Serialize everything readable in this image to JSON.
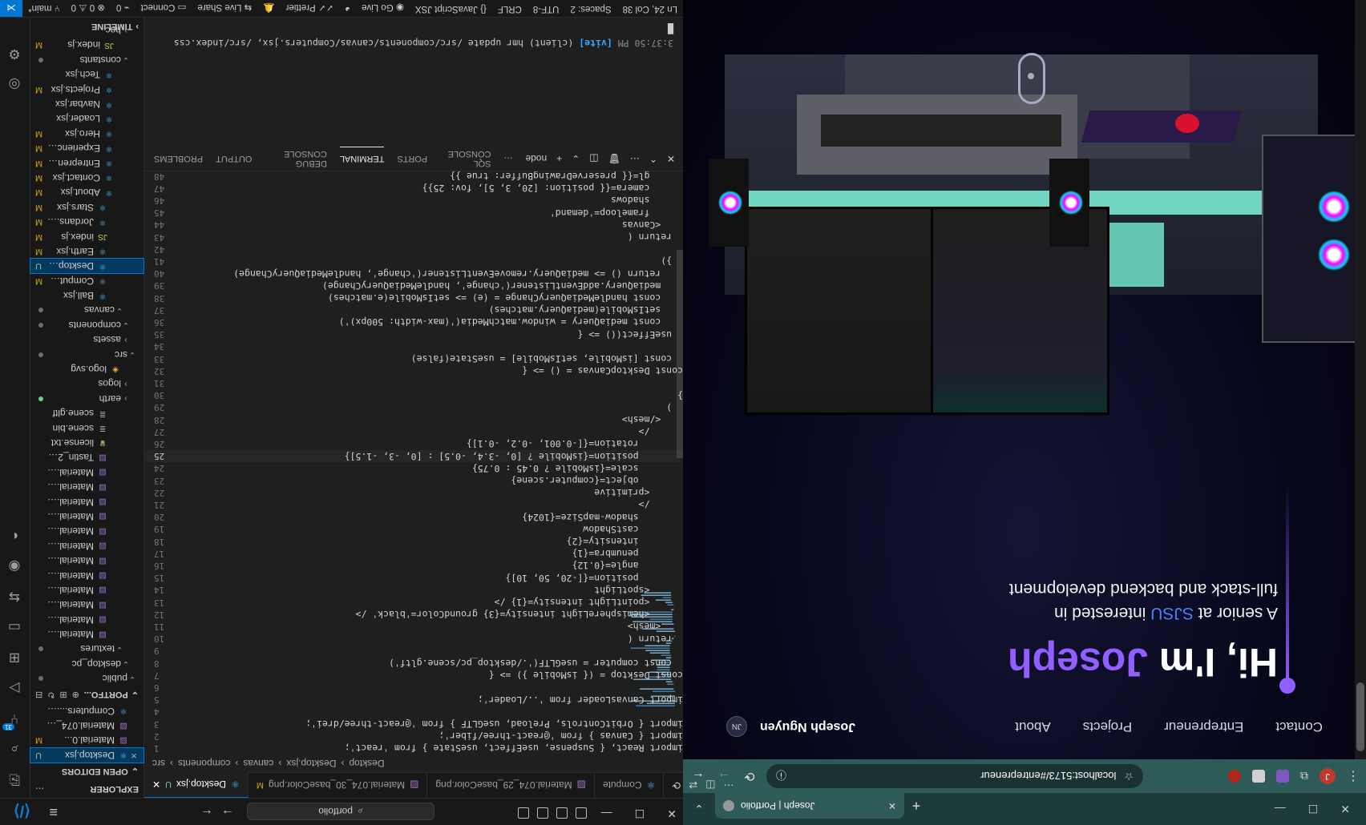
{
  "vscode": {
    "title_bar": {
      "search_text": "portfolio",
      "menu_icon": "hamburger-menu-icon"
    },
    "explorer": {
      "header": "EXPLORER",
      "open_editors_label": "OPEN EDITORS",
      "open_editors": [
        {
          "name": "Desktop.jsx",
          "status": "U",
          "icon": "react"
        },
        {
          "name": "Material.0...",
          "status": "M",
          "icon": "image"
        },
        {
          "name": "Material.074_29_baseColo...",
          "status": "",
          "icon": "image"
        },
        {
          "name": "Computers.... M",
          "status": "",
          "icon": "react"
        }
      ],
      "project_label": "PORTFO...",
      "tree": [
        {
          "name": "public",
          "type": "folder",
          "status": "dot"
        },
        {
          "name": "desktop_pc",
          "type": "folder",
          "status": ""
        },
        {
          "name": "textures",
          "type": "folder",
          "status": "dot"
        },
        {
          "name": "Material.074_29...",
          "type": "image",
          "status": ""
        },
        {
          "name": "Material.07...",
          "type": "image",
          "status": ""
        },
        {
          "name": "Material.074_31...",
          "type": "image",
          "status": ""
        },
        {
          "name": "Material.074_32...",
          "type": "image",
          "status": ""
        },
        {
          "name": "Material.074_33...",
          "type": "image",
          "status": ""
        },
        {
          "name": "Material.074_34...",
          "type": "image",
          "status": ""
        },
        {
          "name": "Material.074_35...",
          "type": "image",
          "status": ""
        },
        {
          "name": "Material.074_36...",
          "type": "image",
          "status": ""
        },
        {
          "name": "Material.074_39...",
          "type": "image",
          "status": ""
        },
        {
          "name": "Material.074_40...",
          "type": "image",
          "status": ""
        },
        {
          "name": "Material.074_69...",
          "type": "image",
          "status": ""
        },
        {
          "name": "Material.074_bas...",
          "type": "image",
          "status": ""
        },
        {
          "name": "Tastin_2_baseCol...",
          "type": "image",
          "status": ""
        },
        {
          "name": "license.txt",
          "type": "license",
          "status": ""
        },
        {
          "name": "scene.bin",
          "type": "bin",
          "status": ""
        },
        {
          "name": "scene.gltf",
          "type": "gltf",
          "status": ""
        },
        {
          "name": "earth",
          "type": "folder-closed",
          "status": "dot-green"
        },
        {
          "name": "logos",
          "type": "folder-closed",
          "status": ""
        },
        {
          "name": "logo.svg",
          "type": "svg",
          "status": ""
        },
        {
          "name": "src",
          "type": "folder",
          "status": "dot"
        },
        {
          "name": "assets",
          "type": "folder-closed",
          "status": ""
        },
        {
          "name": "components",
          "type": "folder",
          "status": "dot"
        },
        {
          "name": "canvas",
          "type": "folder",
          "status": "dot"
        },
        {
          "name": "Ball.jsx",
          "type": "react",
          "status": ""
        },
        {
          "name": "Computers.j...",
          "type": "react",
          "status": "M"
        },
        {
          "name": "Desktop.jsx",
          "type": "react",
          "status": "U",
          "selected": true
        },
        {
          "name": "Earth.jsx",
          "type": "react",
          "status": "M"
        },
        {
          "name": "index.js",
          "type": "js",
          "status": "M"
        },
        {
          "name": "Jordans.jsx",
          "type": "react",
          "status": "M"
        },
        {
          "name": "Stars.jsx",
          "type": "react",
          "status": "M"
        },
        {
          "name": "About.jsx",
          "type": "react",
          "status": "M"
        },
        {
          "name": "Contact.jsx",
          "type": "react",
          "status": "M"
        },
        {
          "name": "Entreprenu...",
          "type": "react",
          "status": "M"
        },
        {
          "name": "Experience.jsx",
          "type": "react",
          "status": "M"
        },
        {
          "name": "Hero.jsx",
          "type": "react",
          "status": "M"
        },
        {
          "name": "Loader.jsx",
          "type": "react",
          "status": ""
        },
        {
          "name": "Navbar.jsx",
          "type": "react",
          "status": ""
        },
        {
          "name": "Projects.jsx",
          "type": "react",
          "status": "M"
        },
        {
          "name": "Tech.jsx",
          "type": "react",
          "status": ""
        },
        {
          "name": "constants",
          "type": "folder",
          "status": "dot"
        },
        {
          "name": "index.js",
          "type": "js",
          "status": "M"
        },
        {
          "name": "hoc",
          "type": "folder-closed",
          "status": ""
        }
      ],
      "timeline_label": "TIMELINE"
    },
    "tabs": [
      {
        "label": "Desktop.jsx",
        "status": "U",
        "active": true
      },
      {
        "label": "Material.074_30_baseColor.png",
        "status": "M",
        "active": false
      },
      {
        "label": "Material.074_29_baseColor.png",
        "status": "",
        "active": false
      },
      {
        "label": "Compute",
        "status": "",
        "active": false
      }
    ],
    "breadcrumbs": [
      "src",
      "components",
      "canvas",
      "Desktop.jsx",
      "Desktop"
    ],
    "code": [
      {
        "n": "1",
        "t": "import React, { Suspense, useEffect, useState } from 'react';"
      },
      {
        "n": "2",
        "t": "import { Canvas } from '@react-three/fiber';"
      },
      {
        "n": "3",
        "t": "import { OrbitControls, Preload, useGLTF } from '@react-three/drei';"
      },
      {
        "n": "4",
        "t": ""
      },
      {
        "n": "5",
        "t": "import CanvasLoader from '../Loader';"
      },
      {
        "n": "6",
        "t": ""
      },
      {
        "n": "7",
        "t": "const Desktop = ({ isMobile }) => {"
      },
      {
        "n": "8",
        "t": "  const computer = useGLTF('./desktop_pc/scene.gltf')"
      },
      {
        "n": "9",
        "t": ""
      },
      {
        "n": "10",
        "t": "  return ("
      },
      {
        "n": "11",
        "t": "    <mesh>"
      },
      {
        "n": "12",
        "t": "      <hemisphereLight intensity={3} groundColor='black' />"
      },
      {
        "n": "13",
        "t": "      <pointLight intensity={1} />"
      },
      {
        "n": "14",
        "t": "      <spotLight"
      },
      {
        "n": "15",
        "t": "        position={[-20, 50, 10]}"
      },
      {
        "n": "16",
        "t": "        angle={0.12}"
      },
      {
        "n": "17",
        "t": "        penumbra={1}"
      },
      {
        "n": "18",
        "t": "        intensity={2}"
      },
      {
        "n": "19",
        "t": "        castShadow"
      },
      {
        "n": "20",
        "t": "        shadow-mapSize={1024}"
      },
      {
        "n": "21",
        "t": "      />"
      },
      {
        "n": "22",
        "t": "      <primitive"
      },
      {
        "n": "23",
        "t": "        object={computer.scene}"
      },
      {
        "n": "24",
        "t": "        scale={isMobile ? 0.45 : 0.75}"
      },
      {
        "n": "25",
        "t": "        position={isMobile ? [0, -3.4, -0.5] : [0, -3, -1.5]}"
      },
      {
        "n": "26",
        "t": "        rotation={[-0.001, -0.2, -0.1]}"
      },
      {
        "n": "27",
        "t": "      />"
      },
      {
        "n": "28",
        "t": "    </mesh>"
      },
      {
        "n": "29",
        "t": "  )"
      },
      {
        "n": "30",
        "t": "}"
      },
      {
        "n": "31",
        "t": ""
      },
      {
        "n": "32",
        "t": "const DesktopCanvas = () => {"
      },
      {
        "n": "33",
        "t": "  const [isMobile, setIsMobile] = useState(false)"
      },
      {
        "n": "34",
        "t": ""
      },
      {
        "n": "35",
        "t": "  useEffect(() => {"
      },
      {
        "n": "36",
        "t": "    const mediaQuery = window.matchMedia('(max-width: 500px)')"
      },
      {
        "n": "37",
        "t": "    setIsMobile(mediaQuery.matches)"
      },
      {
        "n": "38",
        "t": "    const handleMediaQueryChange = (e) => setIsMobile(e.matches)"
      },
      {
        "n": "39",
        "t": "    mediaQuery.addEventListener('change', handleMediaQueryChange)"
      },
      {
        "n": "40",
        "t": "    return () => mediaQuery.removeEventListener('change', handleMediaQueryChange)"
      },
      {
        "n": "41",
        "t": "  })"
      },
      {
        "n": "42",
        "t": ""
      },
      {
        "n": "43",
        "t": "  return ("
      },
      {
        "n": "44",
        "t": "    <Canvas"
      },
      {
        "n": "45",
        "t": "      frameloop='demand'"
      },
      {
        "n": "46",
        "t": "      shadows"
      },
      {
        "n": "47",
        "t": "      camera={{ position: [20, 3, 5], fov: 25}}"
      },
      {
        "n": "48",
        "t": "      gl={{ preserveDrawingBuffer: true }}"
      }
    ],
    "current_line": "25",
    "panel": {
      "tabs": [
        "PROBLEMS",
        "OUTPUT",
        "DEBUG CONSOLE",
        "TERMINAL",
        "PORTS",
        "SQL CONSOLE"
      ],
      "active_tab": "TERMINAL",
      "shell_label": "node",
      "terminal_line_time": "3:37:50 PM",
      "terminal_line_tag": "[vite]",
      "terminal_line_rest": "(client) hmr update /src/components/canvas/Computers.jsx, /src/index.css",
      "cursor": "█"
    },
    "status_bar": {
      "branch": "main*",
      "problems": "⊗ 0 ⚠ 0",
      "ports": "0",
      "connect": "Connect",
      "live_share": "Live Share",
      "position": "Ln 24, Col 38",
      "spaces": "Spaces: 2",
      "encoding": "UTF-8",
      "eol": "CRLF",
      "language": "{} JavaScript JSX",
      "go_live": "Go Live",
      "prettier": "Prettier"
    }
  },
  "browser": {
    "tab_title": "Joseph | Portfolio",
    "url": "localhost:5173/#entrepreneur",
    "avatar_letter": "J",
    "ext_badge": "3",
    "site": {
      "brand": "Joseph Nguyen",
      "nav_links": [
        "About",
        "Projects",
        "Entrepreneur",
        "Contact"
      ],
      "hero_prefix": "Hi, I'm ",
      "hero_name": "Joseph",
      "sub_line1_a": "A senior at ",
      "sub_line1_acc": "SJSU",
      "sub_line1_b": " interested in",
      "sub_line2": "full-stack and backend development",
      "colors": {
        "accent": "#915eff",
        "sjsu": "#4a7fff"
      }
    }
  }
}
